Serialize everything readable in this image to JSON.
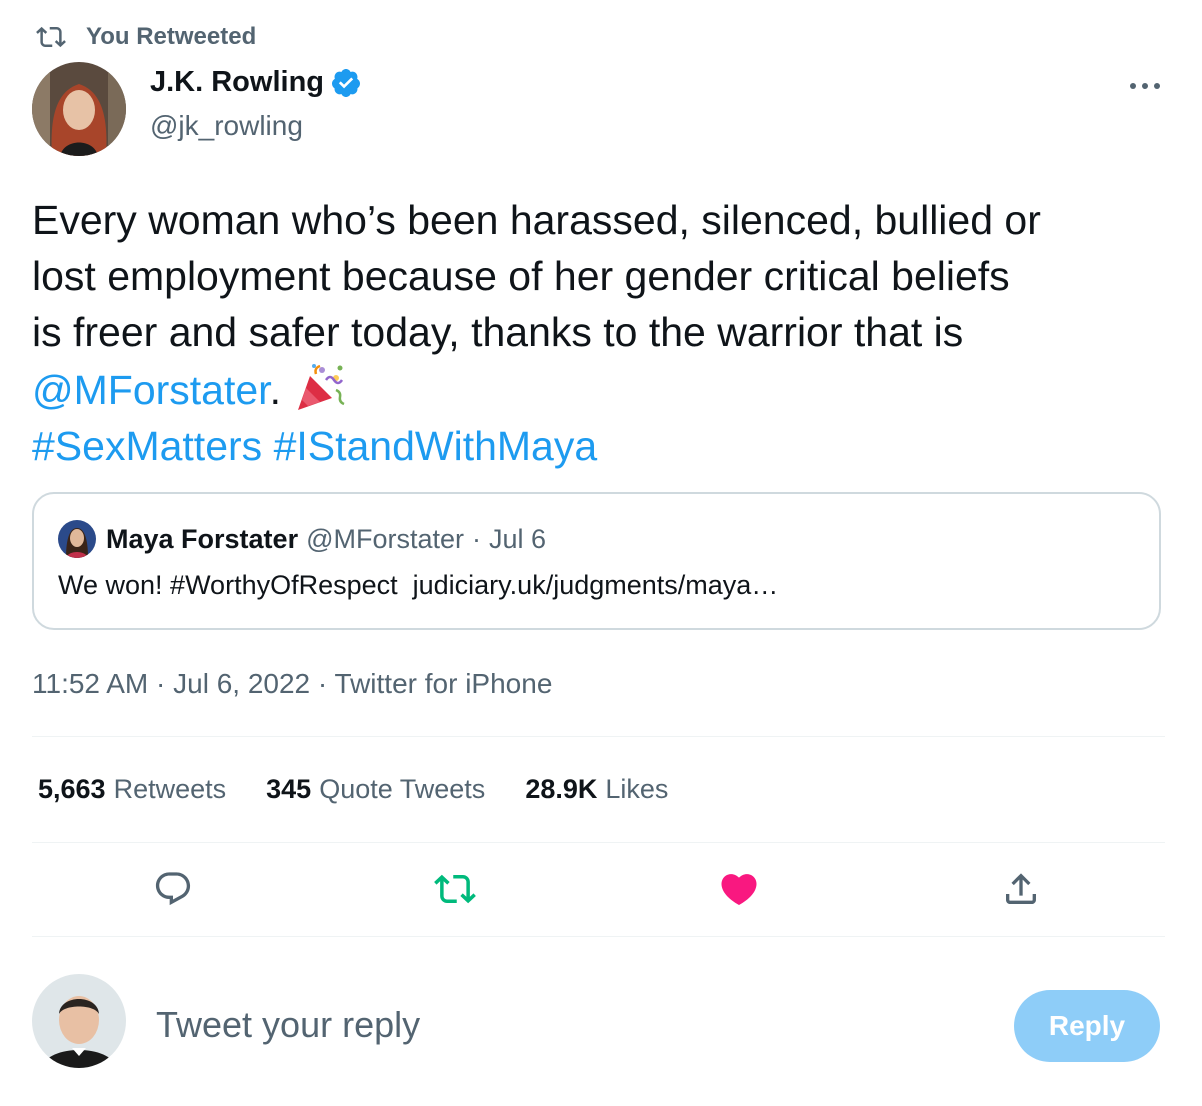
{
  "retweet_banner": {
    "text": "You Retweeted",
    "icon": "retweet-icon"
  },
  "author": {
    "name": "J.K. Rowling",
    "handle": "@jk_rowling",
    "verified": true,
    "verified_color": "#1d9bf0"
  },
  "tweet": {
    "line1": "Every woman who’s been harassed, silenced, bullied or",
    "line2": "lost employment because of her gender critical beliefs",
    "line3": "is freer and safer today, thanks to the warrior that is",
    "mention": "@MForstater",
    "after_mention": ".",
    "emoji": "party-popper-icon",
    "hashtag1": "#SexMatters",
    "hashtag2": "#IStandWithMaya"
  },
  "quoted_tweet": {
    "name": "Maya Forstater",
    "handle": "@MForstater",
    "separator": "·",
    "date": "Jul 6",
    "text": "We won! #WorthyOfRespect  judiciary.uk/judgments/maya…"
  },
  "timestamp": {
    "time": "11:52 AM",
    "sep1": "·",
    "date": "Jul 6, 2022",
    "sep2": "·",
    "source": "Twitter for iPhone"
  },
  "stats": {
    "retweets_count": "5,663",
    "retweets_label": "Retweets",
    "quotes_count": "345",
    "quotes_label": "Quote Tweets",
    "likes_count": "28.9K",
    "likes_label": "Likes"
  },
  "actions": {
    "reply_icon": "reply-icon",
    "retweet_icon": "retweet-icon",
    "like_icon": "heart-icon",
    "share_icon": "share-icon",
    "retweet_color": "#00ba7c",
    "like_color": "#f91880"
  },
  "reply_box": {
    "placeholder": "Tweet your reply",
    "button_label": "Reply",
    "button_color": "#8ecdf8"
  },
  "colors": {
    "link": "#1d9bf0",
    "secondary_text": "#536471",
    "primary_text": "#0f1419"
  }
}
